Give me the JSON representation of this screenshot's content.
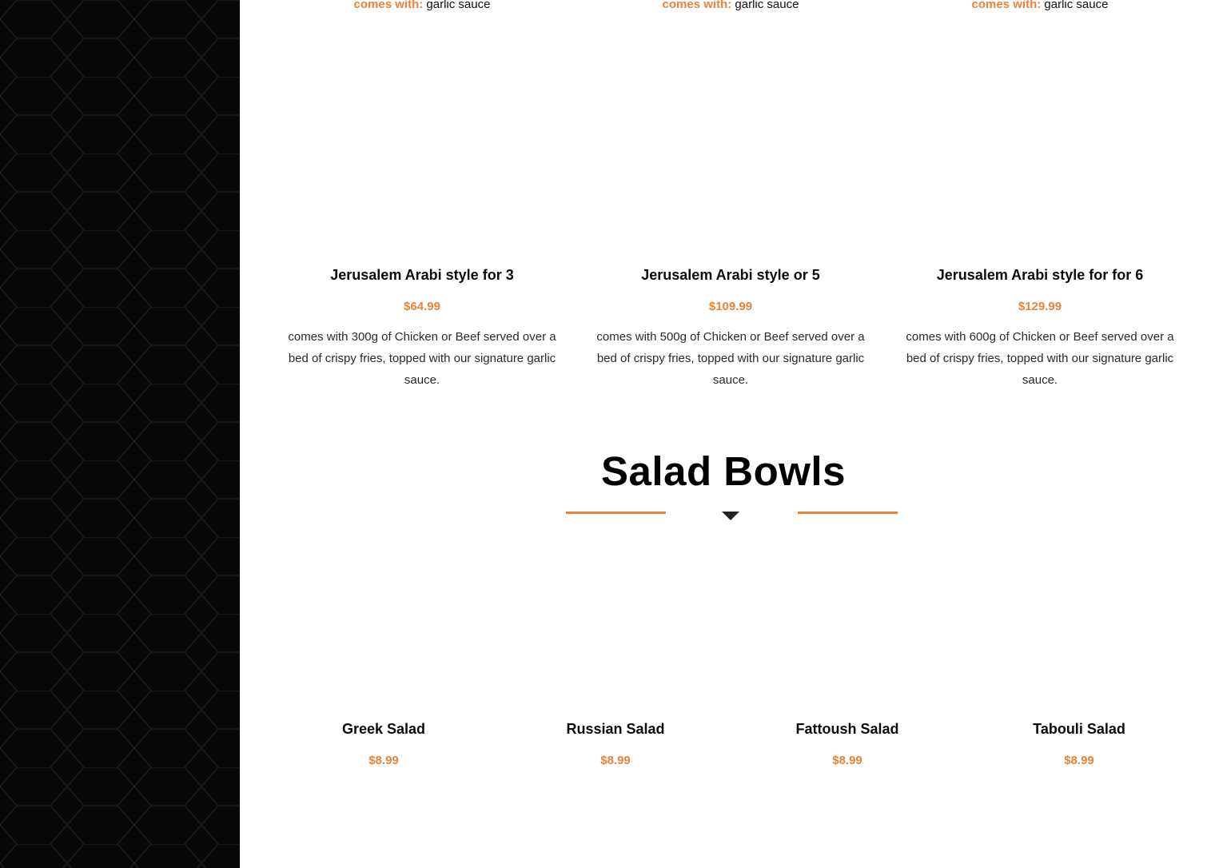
{
  "top_row": [
    {
      "label": "comes with:",
      "value": "garlic sauce"
    },
    {
      "label": "comes with:",
      "value": "garlic sauce"
    },
    {
      "label": "comes with:",
      "value": "garlic sauce"
    }
  ],
  "platters": [
    {
      "name": "Jerusalem Arabi style for 3",
      "price": "$64.99",
      "desc": "comes with 300g of Chicken or Beef served over a bed of crispy fries, topped with our signature garlic sauce."
    },
    {
      "name": "Jerusalem Arabi style or 5",
      "price": "$109.99",
      "desc": "comes with 500g of Chicken or Beef served over a bed of crispy fries, topped with our signature garlic sauce."
    },
    {
      "name": "Jerusalem Arabi style for for 6",
      "price": "$129.99",
      "desc": "comes with 600g of Chicken or Beef served over a bed of crispy fries, topped with our signature garlic sauce."
    }
  ],
  "salad_section": {
    "title": "Salad Bowls",
    "items": [
      {
        "name": "Greek Salad",
        "price": "$8.99"
      },
      {
        "name": "Russian Salad",
        "price": "$8.99"
      },
      {
        "name": "Fattoush Salad",
        "price": "$8.99"
      },
      {
        "name": "Tabouli Salad",
        "price": "$8.99"
      }
    ]
  },
  "colors": {
    "accent": "#e8843a",
    "sidebar": "#070707",
    "background": "#ffffff"
  }
}
